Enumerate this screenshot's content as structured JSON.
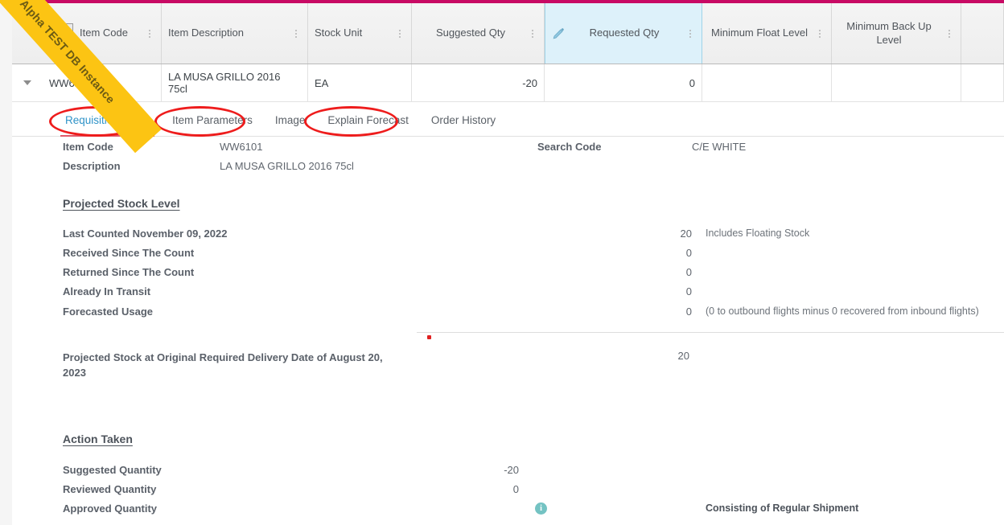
{
  "watermark": {
    "text": "Alpha TEST DB Instance",
    "color": "#fcc413"
  },
  "theme": {
    "accent_bar": "#c80a64",
    "tab_active": "#2f93c8",
    "annotation": "#ee1c1c",
    "edit_column_bg": "#ddf1fa"
  },
  "grid": {
    "resize_icon": "horizontal-resize-icon",
    "columns": [
      {
        "key": "expander",
        "label": ""
      },
      {
        "key": "item_code",
        "label": "Item Code"
      },
      {
        "key": "item_description",
        "label": "Item Description"
      },
      {
        "key": "stock_unit",
        "label": "Stock Unit"
      },
      {
        "key": "suggested_qty",
        "label": "Suggested Qty"
      },
      {
        "key": "requested_qty",
        "label": "Requested Qty"
      },
      {
        "key": "minimum_float_level",
        "label": "Minimum Float Level"
      },
      {
        "key": "minimum_back_up_level",
        "label": "Minimum Back Up Level"
      }
    ],
    "rows": [
      {
        "item_code": "WW6101",
        "item_description": "LA MUSA GRILLO 2016 75cl",
        "stock_unit": "EA",
        "suggested_qty": "-20",
        "requested_qty": "0",
        "minimum_float_level": "",
        "minimum_back_up_level": ""
      }
    ]
  },
  "tabs": [
    {
      "label": "Requisition Detail",
      "active": true,
      "annotated": true
    },
    {
      "label": "Item Parameters",
      "active": false,
      "annotated": true
    },
    {
      "label": "Image",
      "active": false,
      "annotated": false
    },
    {
      "label": "Explain Forecast",
      "active": false,
      "annotated": true
    },
    {
      "label": "Order History",
      "active": false,
      "annotated": false
    }
  ],
  "detail": {
    "item_code_label": "Item Code",
    "item_code_value": "WW6101",
    "description_label": "Description",
    "description_value": "LA MUSA GRILLO 2016 75cl",
    "search_code_label": "Search Code",
    "search_code_value": "C/E WHITE",
    "projected_stock_level": {
      "title": "Projected Stock Level",
      "rows": [
        {
          "label": "Last Counted November 09, 2022",
          "value": "20",
          "note": "Includes Floating Stock"
        },
        {
          "label": "Received Since The Count",
          "value": "0",
          "note": ""
        },
        {
          "label": "Returned Since The Count",
          "value": "0",
          "note": ""
        },
        {
          "label": "Already In Transit",
          "value": "0",
          "note": ""
        },
        {
          "label": "Forecasted Usage",
          "value": "0",
          "note": "(0 to outbound flights minus 0 recovered from inbound flights)"
        }
      ],
      "total_label": "Projected Stock at Original Required Delivery Date of August 20, 2023",
      "total_value": "20"
    },
    "action_taken": {
      "title": "Action Taken",
      "rows": [
        {
          "label": "Suggested Quantity",
          "value": "-20",
          "note": ""
        },
        {
          "label": "Reviewed Quantity",
          "value": "0",
          "note": ""
        },
        {
          "label": "Approved Quantity",
          "value": "",
          "note": "Consisting of Regular Shipment",
          "info_badge": "i"
        }
      ]
    }
  }
}
